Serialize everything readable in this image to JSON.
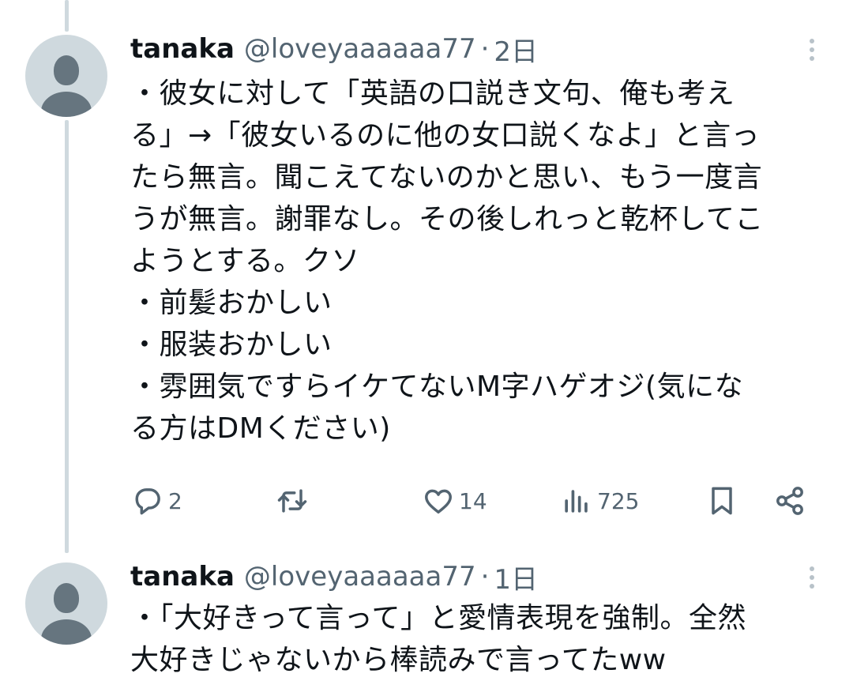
{
  "tweets": [
    {
      "display_name": "tanaka",
      "handle": "@loveyaaaaaa77",
      "separator": "·",
      "time": "2日",
      "lines": [
        "・彼女に対して「英語の口説き文句、俺も考え",
        "る」→「彼女いるのに他の女口説くなよ」と言っ",
        "たら無言。聞こえてないのかと思い、もう一度言",
        "うが無言。謝罪なし。その後しれっと乾杯してこ",
        "ようとする。クソ",
        "・前髪おかしい",
        "・服装おかしい",
        "・雰囲気ですらイケてないM字ハゲオジ(気にな",
        "る方はDMください)"
      ],
      "actions": {
        "reply_count": "2",
        "retweet_count": "",
        "like_count": "14",
        "view_count": "725"
      }
    },
    {
      "display_name": "tanaka",
      "handle": "@loveyaaaaaa77",
      "separator": "·",
      "time": "1日",
      "lines": [
        "・「大好きって言って」と愛情表現を強制。全然",
        "大好きじゃないから棒読みで言ってたww"
      ]
    }
  ],
  "icons": {
    "reply": "reply-icon",
    "retweet": "retweet-icon",
    "like": "like-icon",
    "views": "views-icon",
    "bookmark": "bookmark-icon",
    "share": "share-icon",
    "more": "more-vertical-icon",
    "avatar": "default-avatar-icon"
  },
  "colors": {
    "text": "#0f1419",
    "secondary": "#536471",
    "thread_line": "#cfd9de",
    "avatar_bg": "#cfd9de",
    "avatar_fg": "#66757f"
  }
}
